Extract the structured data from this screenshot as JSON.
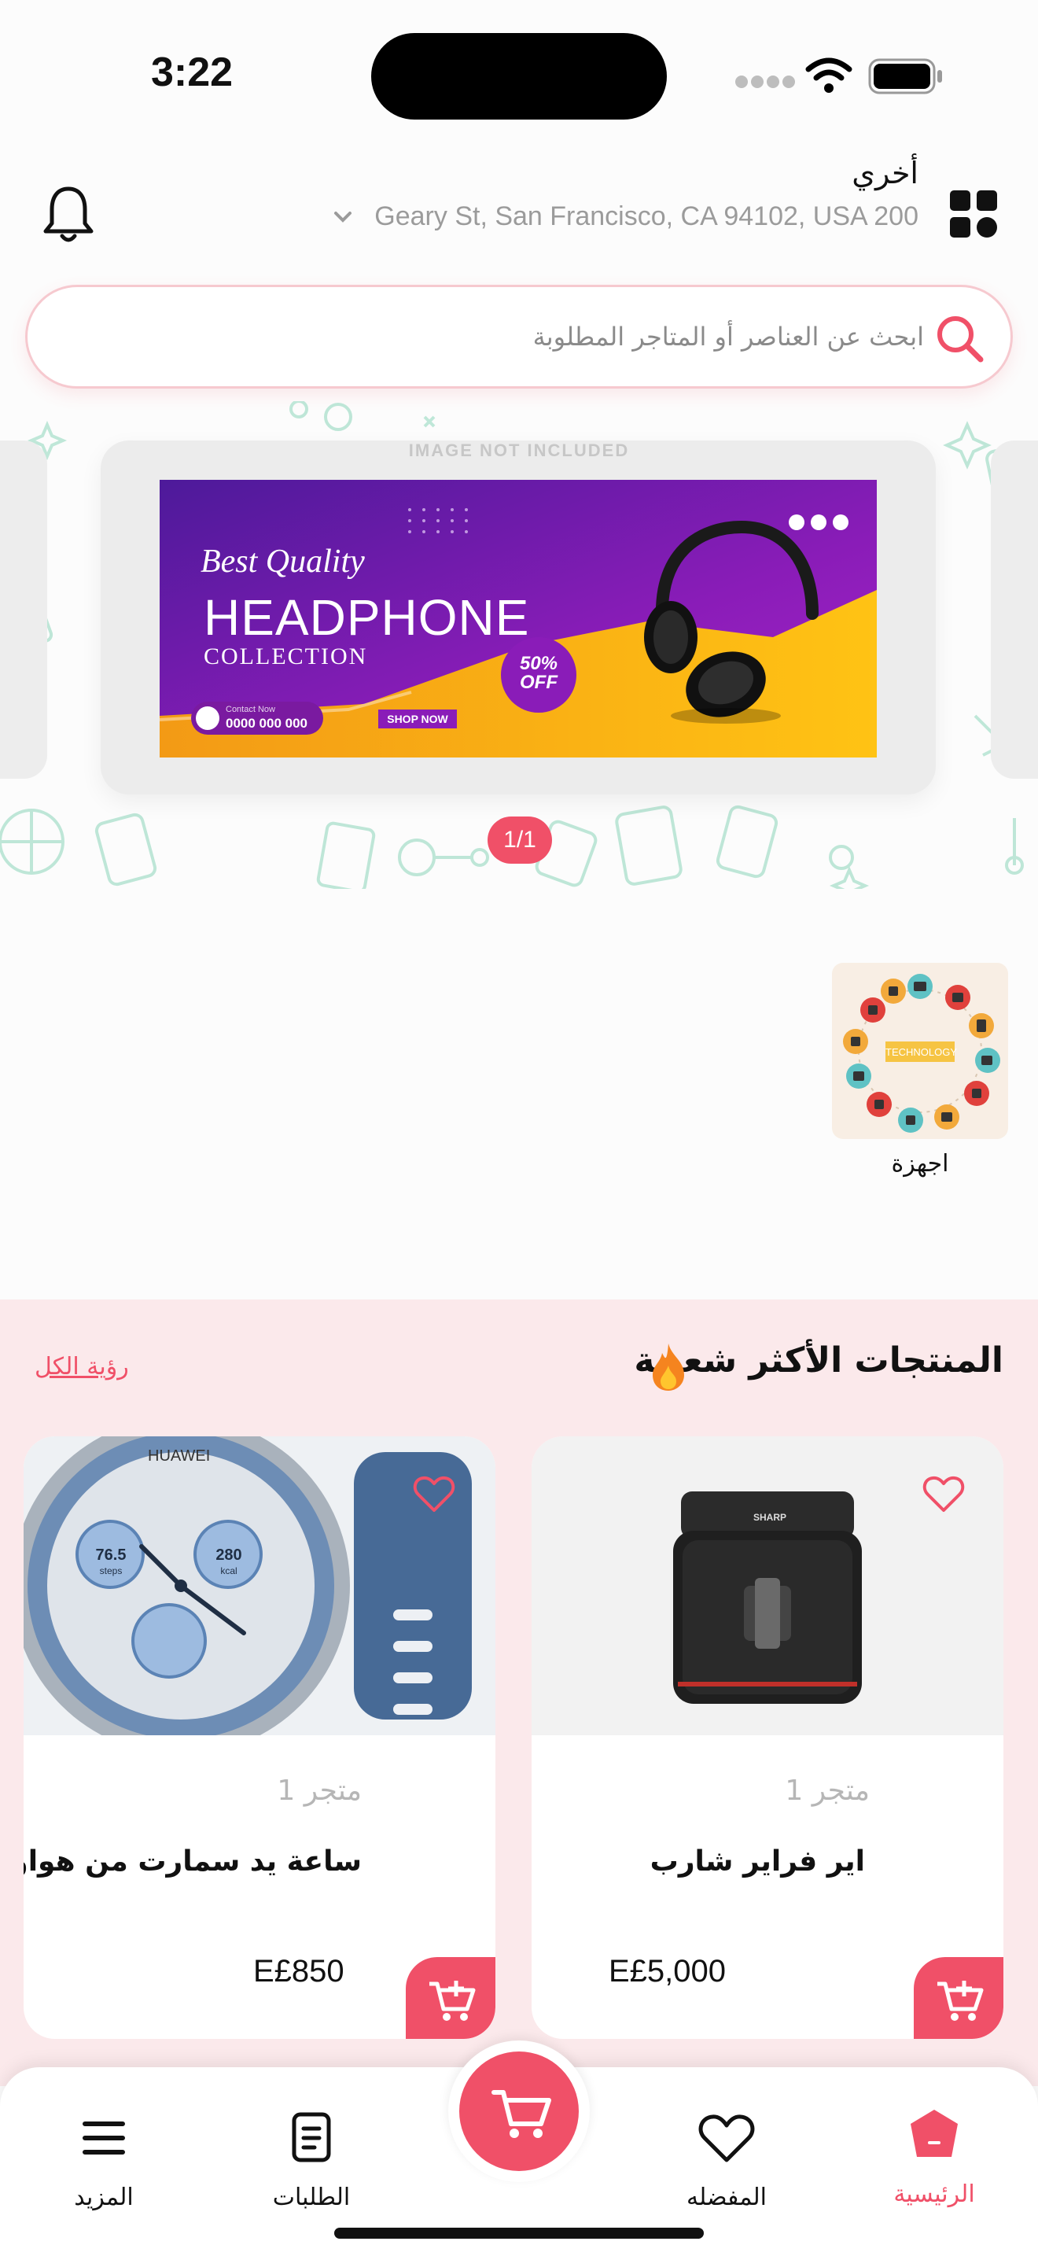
{
  "status": {
    "time": "3:22"
  },
  "header": {
    "location_label": "أخري",
    "address": "Geary St, San Francisco, CA 94102, USA 200"
  },
  "search": {
    "placeholder": "ابحث عن العناصر أو المتاجر المطلوبة"
  },
  "banner": {
    "watermark": "IMAGE NOT INCLUDED",
    "line1": "Best Quality",
    "line2": "HEADPHONE",
    "line3": "COLLECTION",
    "badge_pct": "50%",
    "badge_off": "OFF",
    "contact_label": "Contact Now",
    "contact_number": "0000 000 000",
    "shop_now": "SHOP NOW",
    "pager": "1/1"
  },
  "categories": [
    {
      "label": "اجهزة",
      "tile_text": "TECHNOLOGY"
    }
  ],
  "popular": {
    "title": "المنتجات الأكثر شعبية",
    "see_all": "رؤية الكل",
    "products": [
      {
        "name": "اير  فراير شارب",
        "store": "متجر 1",
        "price": "E£5,000",
        "brand": "SHARP"
      },
      {
        "name": "ساعة يد سمارت من هواوي",
        "store": "متجر 1",
        "price": "E£850",
        "brand": "HUAWEI",
        "dial1": "76.5",
        "dial1_unit": "steps",
        "dial2": "280",
        "dial2_unit": "kcal"
      }
    ]
  },
  "nav": {
    "home": "الرئيسية",
    "favorites": "المفضله",
    "orders": "الطلبات",
    "more": "المزيد"
  },
  "colors": {
    "accent": "#f05068",
    "section_bg": "#fbe9eb"
  }
}
